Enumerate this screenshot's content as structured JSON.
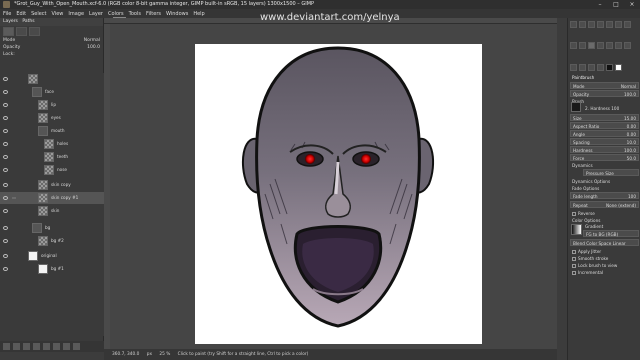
{
  "window": {
    "title": "*Grot_Guy_With_Open_Mouth.xcf-6.0 (RGB color 8-bit gamma integer, GIMP built-in sRGB, 15 layers) 1300x1500 – GIMP",
    "buttons": {
      "minimize": "–",
      "maximize": "□",
      "close": "×"
    }
  },
  "menu": [
    "File",
    "Edit",
    "Select",
    "View",
    "Image",
    "Layer",
    "Colors",
    "Tools",
    "Filters",
    "Windows",
    "Help"
  ],
  "layers_panel": {
    "header": "Layers",
    "tab_label": "Paths",
    "mode_label": "Mode",
    "mode_value": "Normal",
    "opacity_label": "Opacity",
    "opacity_value": "100.0",
    "lock_label": "Lock:",
    "layers": [
      {
        "name": "face",
        "thumb": "folder"
      },
      {
        "name": "lip",
        "thumb": "checker"
      },
      {
        "name": "eyes",
        "thumb": "checker"
      },
      {
        "name": "mouth",
        "thumb": "folder"
      },
      {
        "name": "holes",
        "thumb": "checker"
      },
      {
        "name": "teeth",
        "thumb": "checker"
      },
      {
        "name": "nose",
        "thumb": "checker"
      },
      {
        "name": "skin copy",
        "thumb": "checker"
      },
      {
        "name": "skin copy #1",
        "thumb": "checker"
      },
      {
        "name": "skin",
        "thumb": "checker"
      },
      {
        "name": "bg",
        "thumb": "folder"
      },
      {
        "name": "bg #2",
        "thumb": "checker"
      },
      {
        "name": "original",
        "thumb": "white"
      },
      {
        "name": "bg #1",
        "thumb": "white"
      }
    ]
  },
  "canvas": {
    "watermark": "www.deviantart.com/yelnya"
  },
  "status": {
    "coords": "360.7, 340.0",
    "unit": "px",
    "zoom": "25 %",
    "message": "Click to paint (try Shift for a straight line, Ctrl to pick a color)"
  },
  "tool_options": {
    "title": "Paintbrush",
    "mode_label": "Mode",
    "mode_value": "Normal",
    "opacity_label": "Opacity",
    "opacity_value": "100.0",
    "brush_label": "Brush",
    "brush_value": "2. Hardness 100",
    "size_label": "Size",
    "size_value": "15.00",
    "aspect_label": "Aspect Ratio",
    "aspect_value": "0.00",
    "angle_label": "Angle",
    "angle_value": "0.00",
    "spacing_label": "Spacing",
    "spacing_value": "10.0",
    "hardness_label": "Hardness",
    "hardness_value": "100.0",
    "force_label": "Force",
    "force_value": "50.0",
    "dynamics_label": "Dynamics",
    "dynamics_value": "Pressure Size",
    "dynamics_options_label": "Dynamics Options",
    "fade_label": "Fade Options",
    "fade_length_label": "Fade length",
    "fade_length_value": "100",
    "repeat_label": "Repeat",
    "repeat_value": "None (extend)",
    "reverse_label": "Reverse",
    "color_options_label": "Color Options",
    "gradient_label": "Gradient",
    "gradient_value": "FG to BG (RGB)",
    "blend_label": "Blend Color Space Linear",
    "apply_jitter_label": "Apply Jitter",
    "smooth_stroke_label": "Smooth stroke",
    "lock_canvas_label": "Lock brush to view",
    "incremental_label": "Incremental"
  }
}
